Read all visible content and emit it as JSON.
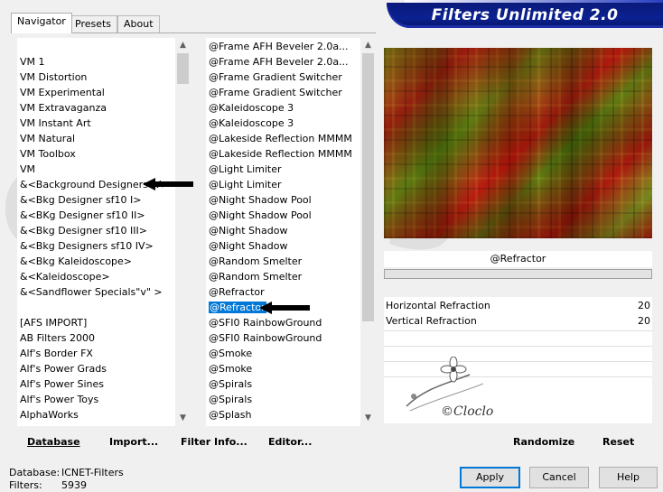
{
  "tabs": [
    "Navigator",
    "Presets",
    "About"
  ],
  "banner_title": "Filters Unlimited 2.0",
  "categories": [
    "VM 1",
    "VM Distortion",
    "VM Experimental",
    "VM Extravaganza",
    "VM Instant Art",
    "VM Natural",
    "VM Toolbox",
    "VM",
    "&<Background Designers IV>",
    "&<Bkg Designer sf10 I>",
    "&<BKg Designer sf10 II>",
    "&<Bkg Designer sf10 III>",
    "&<Bkg Designers sf10 IV>",
    "&<Bkg Kaleidoscope>",
    "&<Kaleidoscope>",
    "&<Sandflower Specials\"v\" >",
    "",
    "[AFS IMPORT]",
    "AB Filters 2000",
    "Alf's Border FX",
    "Alf's Power Grads",
    "Alf's Power Sines",
    "Alf's Power Toys",
    "AlphaWorks"
  ],
  "filters": [
    "@Frame AFH Beveler 2.0a...",
    "@Frame AFH Beveler 2.0a...",
    "@Frame Gradient Switcher",
    "@Frame Gradient Switcher",
    "@Kaleidoscope 3",
    "@Kaleidoscope 3",
    "@Lakeside Reflection MMMM",
    "@Lakeside Reflection MMMM",
    "@Light Limiter",
    "@Light Limiter",
    "@Night Shadow Pool",
    "@Night Shadow Pool",
    "@Night Shadow",
    "@Night Shadow",
    "@Random Smelter",
    "@Random Smelter",
    "@Refractor",
    "@Refractor",
    "@SFI0 RainbowGround",
    "@SFI0 RainbowGround",
    "@Smoke",
    "@Smoke",
    "@Spirals",
    "@Spirals",
    "@Splash"
  ],
  "selected_filter_index": 17,
  "current_filter": "@Refractor",
  "params": [
    {
      "label": "Horizontal Refraction",
      "value": "20"
    },
    {
      "label": "Vertical Refraction",
      "value": "20"
    }
  ],
  "toolbar": {
    "database": "Database",
    "import": "Import...",
    "filter_info": "Filter Info...",
    "editor": "Editor...",
    "randomize": "Randomize",
    "reset": "Reset"
  },
  "status": {
    "database_label": "Database:",
    "database_value": "ICNET-Filters",
    "filters_label": "Filters:",
    "filters_value": "5939"
  },
  "buttons": {
    "apply": "Apply",
    "cancel": "Cancel",
    "help": "Help"
  },
  "watermark_text": "©Cloclo",
  "background_watermark": "OVERS",
  "colors": {
    "selection": "#0078d7",
    "banner": "#0b2191"
  }
}
